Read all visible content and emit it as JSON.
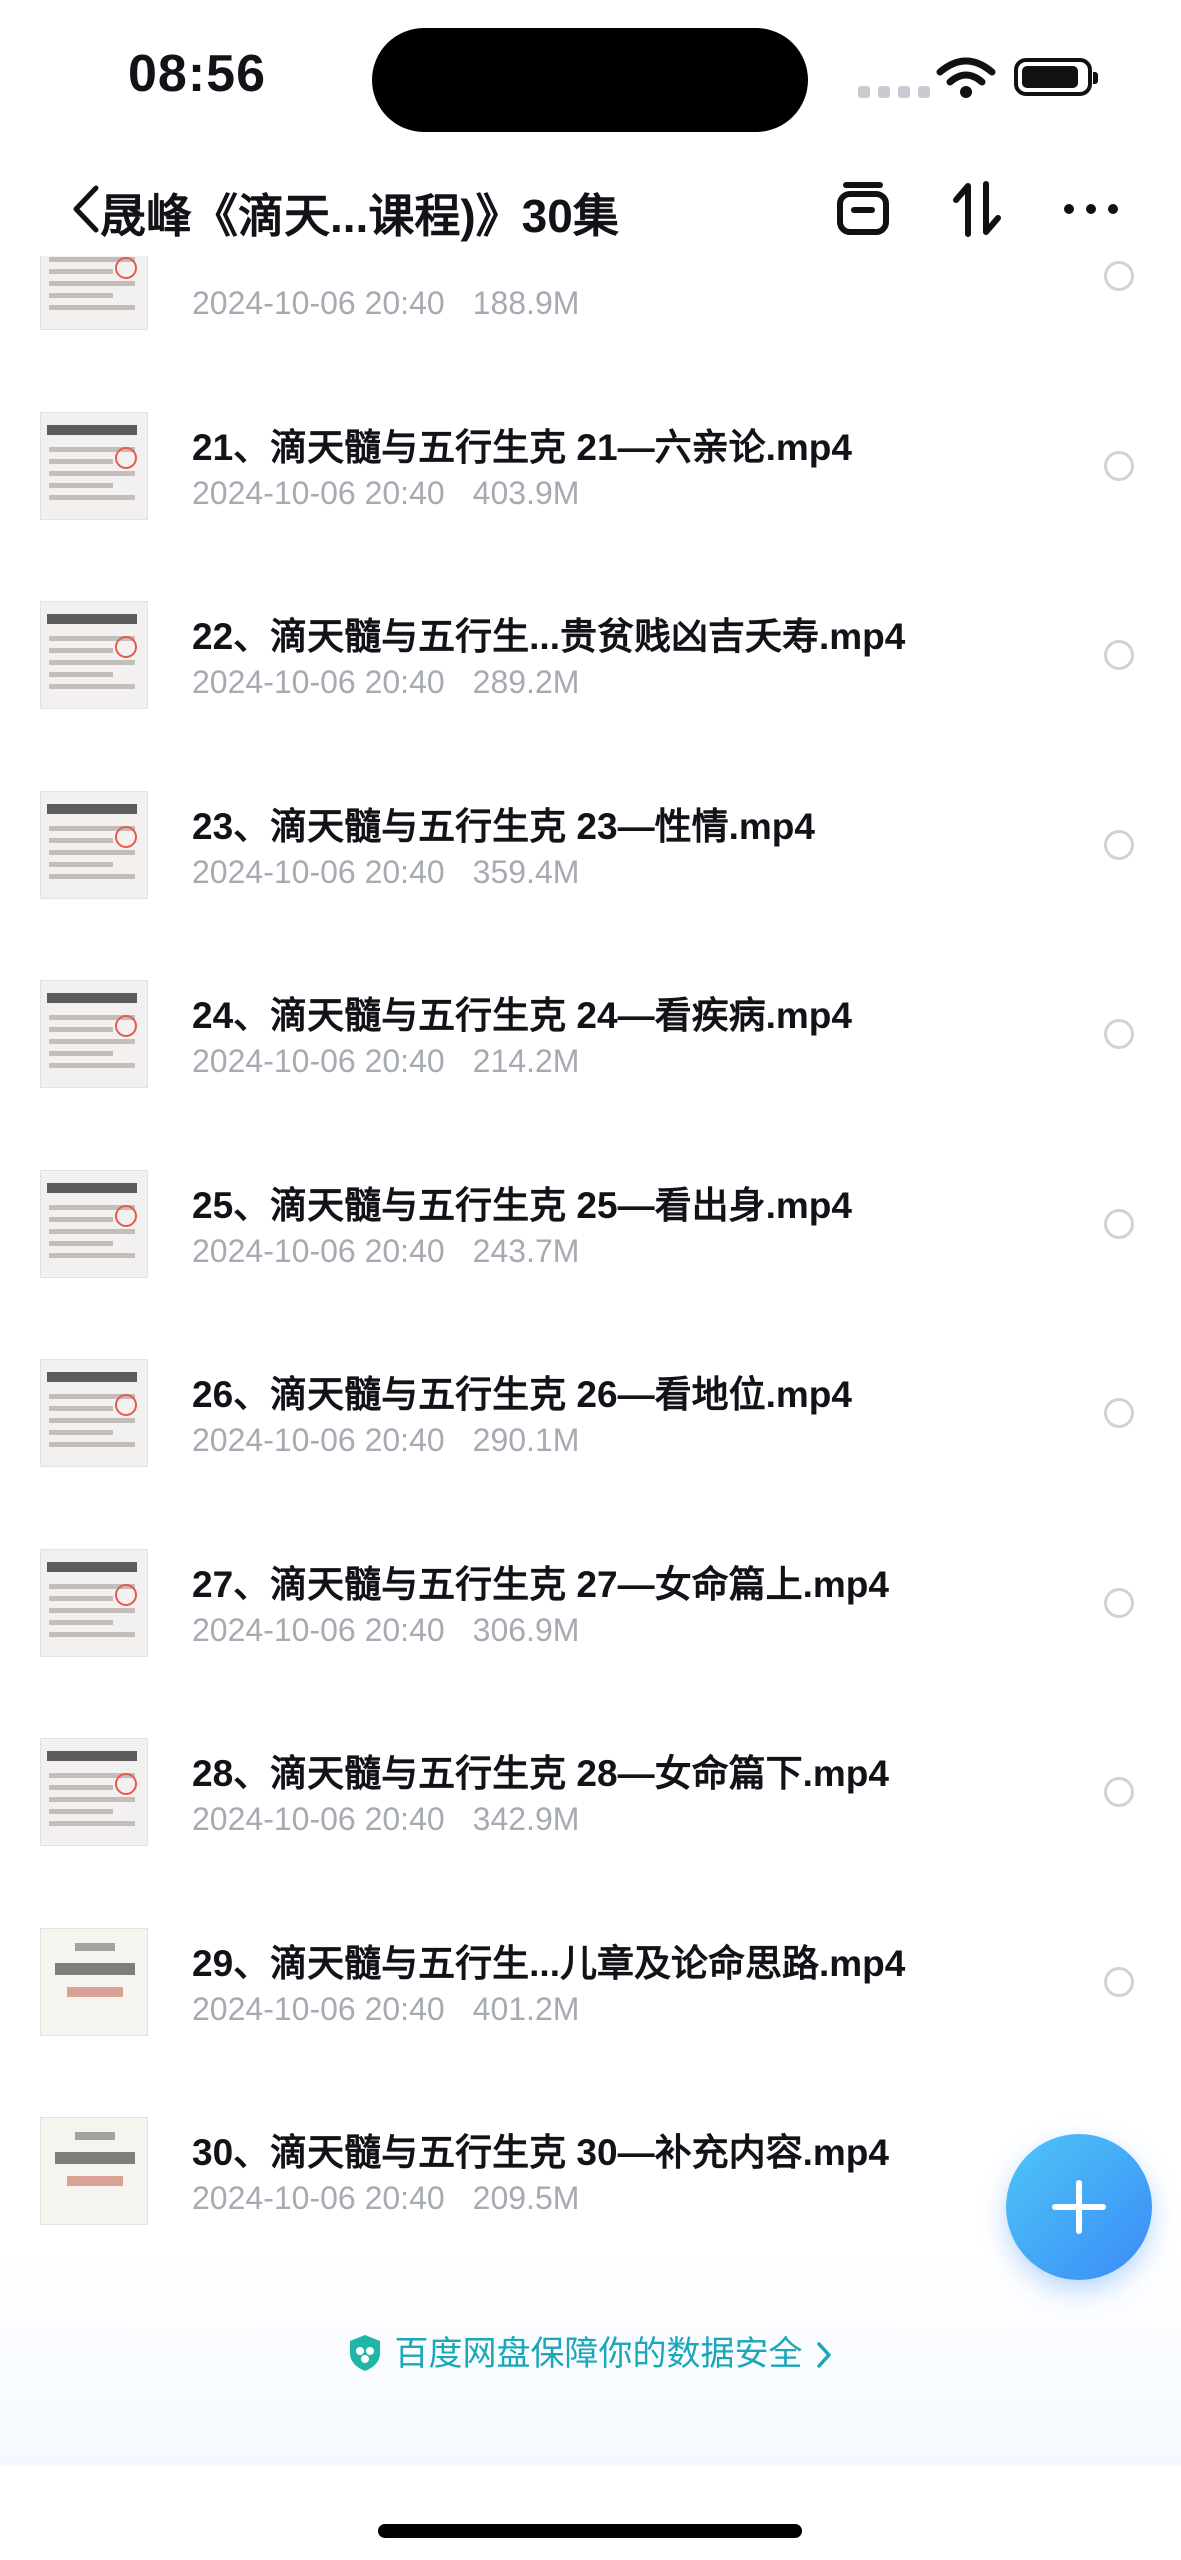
{
  "status_bar": {
    "time": "08:56"
  },
  "nav": {
    "title": "晟峰《滴天...课程)》30集",
    "icons": [
      "back-chevron-icon",
      "select-icon",
      "sort-icon",
      "more-icon"
    ]
  },
  "files": [
    {
      "name": "",
      "date": "2024-10-06 20:40",
      "size": "188.9M",
      "thumb": "slide"
    },
    {
      "name": "21、滴天髓与五行生克 21—六亲论.mp4",
      "date": "2024-10-06 20:40",
      "size": "403.9M",
      "thumb": "slide"
    },
    {
      "name": "22、滴天髓与五行生...贵贫贱凶吉夭寿.mp4",
      "date": "2024-10-06 20:40",
      "size": "289.2M",
      "thumb": "slide"
    },
    {
      "name": "23、滴天髓与五行生克 23—性情.mp4",
      "date": "2024-10-06 20:40",
      "size": "359.4M",
      "thumb": "slide"
    },
    {
      "name": "24、滴天髓与五行生克 24—看疾病.mp4",
      "date": "2024-10-06 20:40",
      "size": "214.2M",
      "thumb": "slide"
    },
    {
      "name": "25、滴天髓与五行生克 25—看出身.mp4",
      "date": "2024-10-06 20:40",
      "size": "243.7M",
      "thumb": "slide"
    },
    {
      "name": "26、滴天髓与五行生克 26—看地位.mp4",
      "date": "2024-10-06 20:40",
      "size": "290.1M",
      "thumb": "slide"
    },
    {
      "name": "27、滴天髓与五行生克 27—女命篇上.mp4",
      "date": "2024-10-06 20:40",
      "size": "306.9M",
      "thumb": "slide"
    },
    {
      "name": "28、滴天髓与五行生克 28—女命篇下.mp4",
      "date": "2024-10-06 20:40",
      "size": "342.9M",
      "thumb": "slide"
    },
    {
      "name": "29、滴天髓与五行生...儿章及论命思路.mp4",
      "date": "2024-10-06 20:40",
      "size": "401.2M",
      "thumb": "title-card"
    },
    {
      "name": "30、滴天髓与五行生克 30—补充内容.mp4",
      "date": "2024-10-06 20:40",
      "size": "209.5M",
      "thumb": "title-card"
    }
  ],
  "fab": {
    "icon": "plus-icon"
  },
  "footer": {
    "safety_note": "百度网盘保障你的数据安全"
  },
  "colors": {
    "accent": "#3a8bf7",
    "safety_text": "#1aa7b8",
    "meta_text": "#a6aab2"
  }
}
